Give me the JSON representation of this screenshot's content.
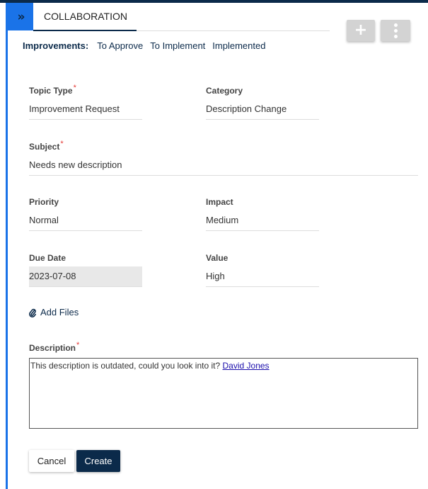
{
  "colors": {
    "primary_dark": "#0b2a4a",
    "accent_blue": "#1a73e8",
    "required": "#e53935"
  },
  "header": {
    "expand_icon": "double-chevron-right-icon",
    "expand_glyph": "»",
    "tab_label": "COLLABORATION",
    "add_icon": "plus-icon",
    "add_glyph": "+",
    "more_icon": "kebab-menu-icon"
  },
  "subnav": {
    "label": "Improvements:",
    "links": [
      "To Approve",
      "To Implement",
      "Implemented"
    ]
  },
  "form": {
    "required_mark": "*",
    "topic_type": {
      "label": "Topic Type",
      "value": "Improvement Request",
      "required": true
    },
    "category": {
      "label": "Category",
      "value": "Description Change"
    },
    "subject": {
      "label": "Subject",
      "value": "Needs new description",
      "required": true
    },
    "priority": {
      "label": "Priority",
      "value": "Normal"
    },
    "impact": {
      "label": "Impact",
      "value": "Medium"
    },
    "due_date": {
      "label": "Due Date",
      "value": "2023-07-08"
    },
    "value": {
      "label": "Value",
      "value": "High"
    },
    "add_files": {
      "label": "Add Files",
      "icon": "paperclip-icon"
    },
    "description": {
      "label": "Description",
      "required": true,
      "text": "This description is outdated, could you look into it? ",
      "mention": "David Jones"
    }
  },
  "actions": {
    "cancel_label": "Cancel",
    "create_label": "Create"
  }
}
